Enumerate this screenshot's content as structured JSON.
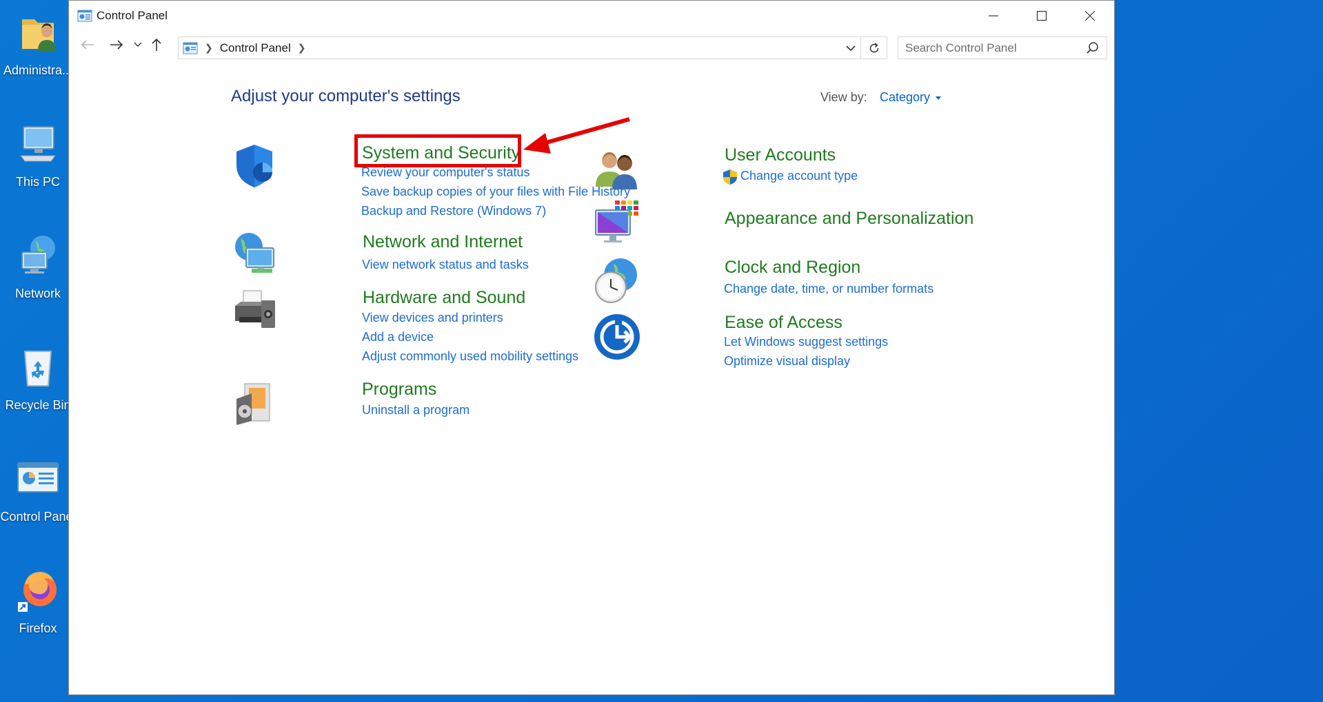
{
  "desktop": {
    "icons": [
      {
        "label": "Administra..."
      },
      {
        "label": "This PC"
      },
      {
        "label": "Network"
      },
      {
        "label": "Recycle Bin"
      },
      {
        "label": "Control Panel"
      },
      {
        "label": "Firefox"
      }
    ]
  },
  "window": {
    "title": "Control Panel",
    "breadcrumb": "Control Panel",
    "search_placeholder": "Search Control Panel"
  },
  "content": {
    "heading": "Adjust your computer's settings",
    "view_by_label": "View by:",
    "view_by_value": "Category",
    "left_categories": [
      {
        "title": "System and Security",
        "links": [
          "Review your computer's status",
          "Save backup copies of your files with File History",
          "Backup and Restore (Windows 7)"
        ]
      },
      {
        "title": "Network and Internet",
        "links": [
          "View network status and tasks"
        ]
      },
      {
        "title": "Hardware and Sound",
        "links": [
          "View devices and printers",
          "Add a device",
          "Adjust commonly used mobility settings"
        ]
      },
      {
        "title": "Programs",
        "links": [
          "Uninstall a program"
        ]
      }
    ],
    "right_categories": [
      {
        "title": "User Accounts",
        "links": [
          "Change account type"
        ]
      },
      {
        "title": "Appearance and Personalization",
        "links": []
      },
      {
        "title": "Clock and Region",
        "links": [
          "Change date, time, or number formats"
        ]
      },
      {
        "title": "Ease of Access",
        "links": [
          "Let Windows suggest settings",
          "Optimize visual display"
        ]
      }
    ]
  },
  "annotation": {
    "highlight_color": "#e60000"
  },
  "colors": {
    "desktop": "#0a78d4",
    "category_title": "#1f7b1f",
    "link": "#1c6dd0",
    "heading": "#1e3a8a"
  }
}
